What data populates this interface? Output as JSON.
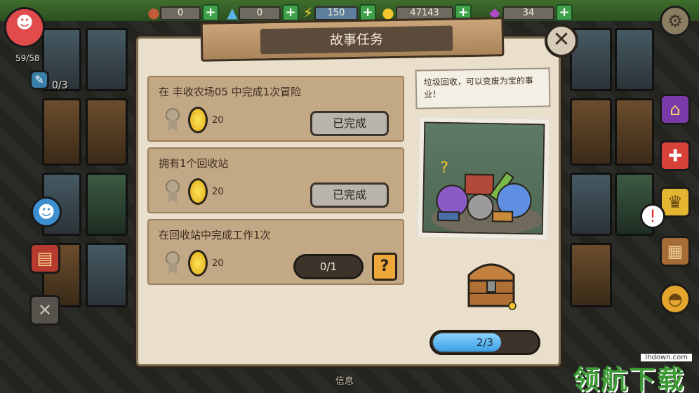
{
  "resources": [
    {
      "icon": "mushroom-icon",
      "value": "0"
    },
    {
      "icon": "water-drop-icon",
      "value": "0"
    },
    {
      "icon": "lightning-icon",
      "value": "150"
    },
    {
      "icon": "coin-icon",
      "value": "47143"
    },
    {
      "icon": "gem-icon",
      "value": "34"
    }
  ],
  "hud": {
    "population": "59/58",
    "tool_count": "0/3"
  },
  "modal": {
    "title": "故事任务",
    "tasks": [
      {
        "title": "在 丰收农场05 中完成1次冒险",
        "reward": "20",
        "status": "已完成",
        "done": true
      },
      {
        "title": "拥有1个回收站",
        "reward": "20",
        "status": "已完成",
        "done": true
      },
      {
        "title": "在回收站中完成工作1次",
        "reward": "20",
        "progress": "0/1",
        "done": false
      }
    ],
    "story_note": "垃圾回收，可以变废为宝的事业！",
    "chest_progress": {
      "label": "2/3",
      "fraction": 0.667
    }
  },
  "bottom_hint": "信息",
  "watermark": {
    "url": "lhdown.com",
    "text": "领航下载"
  },
  "colors": {
    "modal_bg": "#e9dfcb",
    "task_bg": "#c3a886",
    "plus_green": "#3fa24a",
    "coin_gold": "#f2c52a",
    "help_orange": "#f0a73a",
    "progress_blue": "#3b9ee6"
  }
}
